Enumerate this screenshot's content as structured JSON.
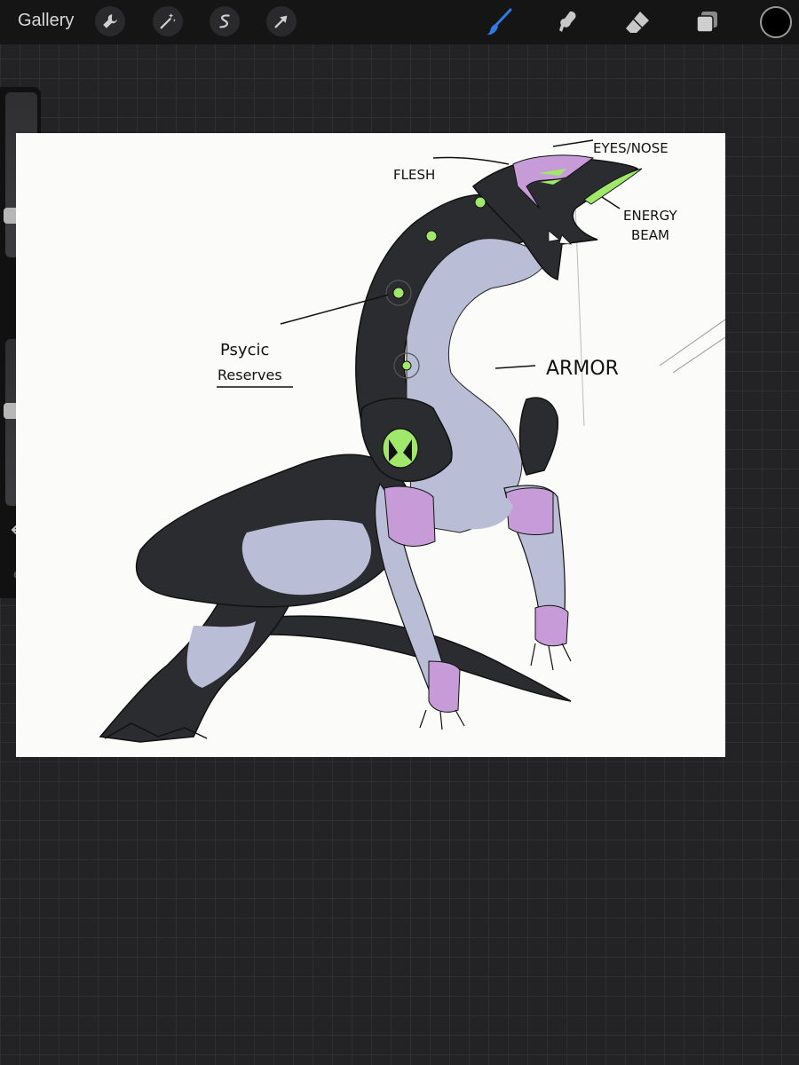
{
  "topbar": {
    "gallery_label": "Gallery",
    "left_tools": [
      "wrench-icon",
      "magic-wand-icon",
      "selection-icon",
      "transform-arrow-icon"
    ],
    "right_tools": [
      "brush-icon",
      "smudge-icon",
      "eraser-icon",
      "layers-icon"
    ],
    "active_tool": "brush",
    "current_color": "#000000",
    "accent_color": "#2f7ae5"
  },
  "sidebar": {
    "controls": [
      "brush-size-slider",
      "modify-button",
      "opacity-slider",
      "undo-icon",
      "redo-icon"
    ]
  },
  "canvas": {
    "annotations": {
      "eyes_nose": "EYES/NOSE",
      "flesh": "FLESH",
      "energy": "ENERGY",
      "beam": "BEAM",
      "psycic": "Psycic",
      "reserves": "Reserves",
      "armor": "ARMOR"
    },
    "colors": {
      "armor_dark": "#2b2c30",
      "flesh_gray": "#b9bdd6",
      "purple": "#c79bd8",
      "green": "#9fe86a"
    }
  }
}
